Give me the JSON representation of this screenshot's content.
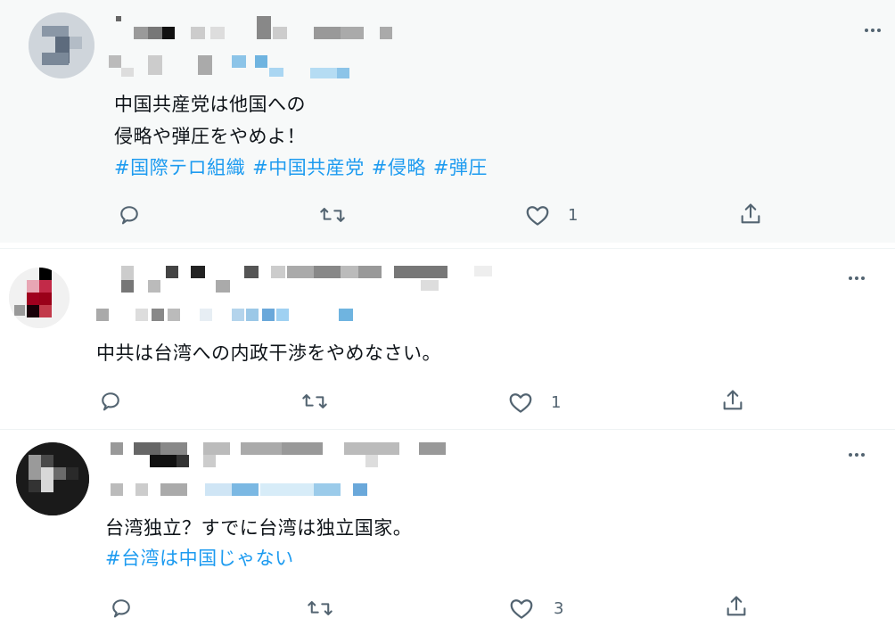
{
  "tweets": [
    {
      "text_lines": [
        "中国共産党は他国への",
        "侵略や弾圧をやめよ！"
      ],
      "hashtags": [
        "#国際テロ組織",
        "#中国共産党",
        "#侵略",
        "#弾圧"
      ],
      "like_count": "1",
      "reply_count": "",
      "retweet_count": ""
    },
    {
      "text_lines": [
        "中共は台湾への内政干渉をやめなさい。"
      ],
      "hashtags": [],
      "like_count": "1",
      "reply_count": "",
      "retweet_count": ""
    },
    {
      "text_lines": [
        "台湾独立？すでに台湾は独立国家。"
      ],
      "hashtags": [
        "#台湾は中国じゃない"
      ],
      "like_count": "3",
      "reply_count": "",
      "retweet_count": ""
    }
  ],
  "icons": {
    "reply": "reply-icon",
    "retweet": "retweet-icon",
    "like": "heart-icon",
    "share": "share-icon",
    "more": "more-icon"
  },
  "colors": {
    "hashtag": "#1d9bf0",
    "icon": "#536471",
    "highlight_bg": "#f7f9f9"
  }
}
